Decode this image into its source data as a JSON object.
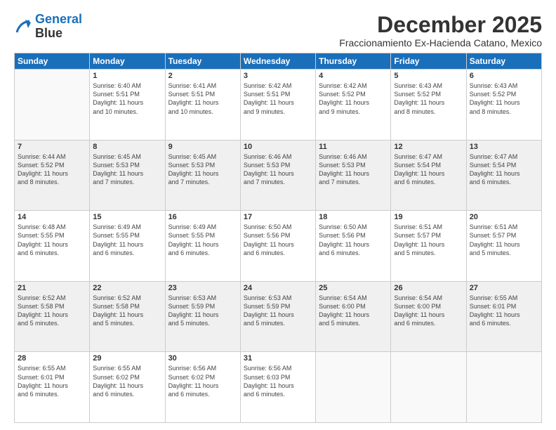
{
  "header": {
    "logo_line1": "General",
    "logo_line2": "Blue",
    "month": "December 2025",
    "location": "Fraccionamiento Ex-Hacienda Catano, Mexico"
  },
  "days_of_week": [
    "Sunday",
    "Monday",
    "Tuesday",
    "Wednesday",
    "Thursday",
    "Friday",
    "Saturday"
  ],
  "weeks": [
    [
      {
        "day": "",
        "info": ""
      },
      {
        "day": "1",
        "info": "Sunrise: 6:40 AM\nSunset: 5:51 PM\nDaylight: 11 hours\nand 10 minutes."
      },
      {
        "day": "2",
        "info": "Sunrise: 6:41 AM\nSunset: 5:51 PM\nDaylight: 11 hours\nand 10 minutes."
      },
      {
        "day": "3",
        "info": "Sunrise: 6:42 AM\nSunset: 5:51 PM\nDaylight: 11 hours\nand 9 minutes."
      },
      {
        "day": "4",
        "info": "Sunrise: 6:42 AM\nSunset: 5:52 PM\nDaylight: 11 hours\nand 9 minutes."
      },
      {
        "day": "5",
        "info": "Sunrise: 6:43 AM\nSunset: 5:52 PM\nDaylight: 11 hours\nand 8 minutes."
      },
      {
        "day": "6",
        "info": "Sunrise: 6:43 AM\nSunset: 5:52 PM\nDaylight: 11 hours\nand 8 minutes."
      }
    ],
    [
      {
        "day": "7",
        "info": "Sunrise: 6:44 AM\nSunset: 5:52 PM\nDaylight: 11 hours\nand 8 minutes."
      },
      {
        "day": "8",
        "info": "Sunrise: 6:45 AM\nSunset: 5:53 PM\nDaylight: 11 hours\nand 7 minutes."
      },
      {
        "day": "9",
        "info": "Sunrise: 6:45 AM\nSunset: 5:53 PM\nDaylight: 11 hours\nand 7 minutes."
      },
      {
        "day": "10",
        "info": "Sunrise: 6:46 AM\nSunset: 5:53 PM\nDaylight: 11 hours\nand 7 minutes."
      },
      {
        "day": "11",
        "info": "Sunrise: 6:46 AM\nSunset: 5:53 PM\nDaylight: 11 hours\nand 7 minutes."
      },
      {
        "day": "12",
        "info": "Sunrise: 6:47 AM\nSunset: 5:54 PM\nDaylight: 11 hours\nand 6 minutes."
      },
      {
        "day": "13",
        "info": "Sunrise: 6:47 AM\nSunset: 5:54 PM\nDaylight: 11 hours\nand 6 minutes."
      }
    ],
    [
      {
        "day": "14",
        "info": "Sunrise: 6:48 AM\nSunset: 5:55 PM\nDaylight: 11 hours\nand 6 minutes."
      },
      {
        "day": "15",
        "info": "Sunrise: 6:49 AM\nSunset: 5:55 PM\nDaylight: 11 hours\nand 6 minutes."
      },
      {
        "day": "16",
        "info": "Sunrise: 6:49 AM\nSunset: 5:55 PM\nDaylight: 11 hours\nand 6 minutes."
      },
      {
        "day": "17",
        "info": "Sunrise: 6:50 AM\nSunset: 5:56 PM\nDaylight: 11 hours\nand 6 minutes."
      },
      {
        "day": "18",
        "info": "Sunrise: 6:50 AM\nSunset: 5:56 PM\nDaylight: 11 hours\nand 6 minutes."
      },
      {
        "day": "19",
        "info": "Sunrise: 6:51 AM\nSunset: 5:57 PM\nDaylight: 11 hours\nand 5 minutes."
      },
      {
        "day": "20",
        "info": "Sunrise: 6:51 AM\nSunset: 5:57 PM\nDaylight: 11 hours\nand 5 minutes."
      }
    ],
    [
      {
        "day": "21",
        "info": "Sunrise: 6:52 AM\nSunset: 5:58 PM\nDaylight: 11 hours\nand 5 minutes."
      },
      {
        "day": "22",
        "info": "Sunrise: 6:52 AM\nSunset: 5:58 PM\nDaylight: 11 hours\nand 5 minutes."
      },
      {
        "day": "23",
        "info": "Sunrise: 6:53 AM\nSunset: 5:59 PM\nDaylight: 11 hours\nand 5 minutes."
      },
      {
        "day": "24",
        "info": "Sunrise: 6:53 AM\nSunset: 5:59 PM\nDaylight: 11 hours\nand 5 minutes."
      },
      {
        "day": "25",
        "info": "Sunrise: 6:54 AM\nSunset: 6:00 PM\nDaylight: 11 hours\nand 5 minutes."
      },
      {
        "day": "26",
        "info": "Sunrise: 6:54 AM\nSunset: 6:00 PM\nDaylight: 11 hours\nand 6 minutes."
      },
      {
        "day": "27",
        "info": "Sunrise: 6:55 AM\nSunset: 6:01 PM\nDaylight: 11 hours\nand 6 minutes."
      }
    ],
    [
      {
        "day": "28",
        "info": "Sunrise: 6:55 AM\nSunset: 6:01 PM\nDaylight: 11 hours\nand 6 minutes."
      },
      {
        "day": "29",
        "info": "Sunrise: 6:55 AM\nSunset: 6:02 PM\nDaylight: 11 hours\nand 6 minutes."
      },
      {
        "day": "30",
        "info": "Sunrise: 6:56 AM\nSunset: 6:02 PM\nDaylight: 11 hours\nand 6 minutes."
      },
      {
        "day": "31",
        "info": "Sunrise: 6:56 AM\nSunset: 6:03 PM\nDaylight: 11 hours\nand 6 minutes."
      },
      {
        "day": "",
        "info": ""
      },
      {
        "day": "",
        "info": ""
      },
      {
        "day": "",
        "info": ""
      }
    ]
  ]
}
